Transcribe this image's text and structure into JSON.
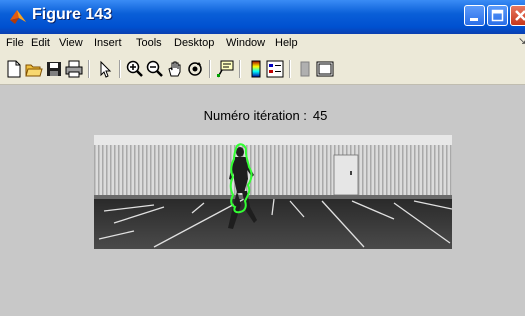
{
  "window": {
    "title": "Figure 143"
  },
  "menu": {
    "items": [
      "File",
      "Edit",
      "View",
      "Insert",
      "Tools",
      "Desktop",
      "Window",
      "Help"
    ]
  },
  "toolbar": {
    "icons": [
      "new-file-icon",
      "open-folder-icon",
      "save-icon",
      "print-icon",
      "arrow-pointer-icon",
      "zoom-in-icon",
      "zoom-out-icon",
      "pan-hand-icon",
      "rotate-3d-icon",
      "data-cursor-icon",
      "colorbar-icon",
      "legend-icon",
      "hide-plot-tools-icon",
      "show-plot-tools-icon"
    ]
  },
  "figure": {
    "label": "Numéro itération :",
    "value": "45"
  },
  "colors": {
    "titlebar": "#0a5fd8",
    "contour": "#33ff33"
  }
}
